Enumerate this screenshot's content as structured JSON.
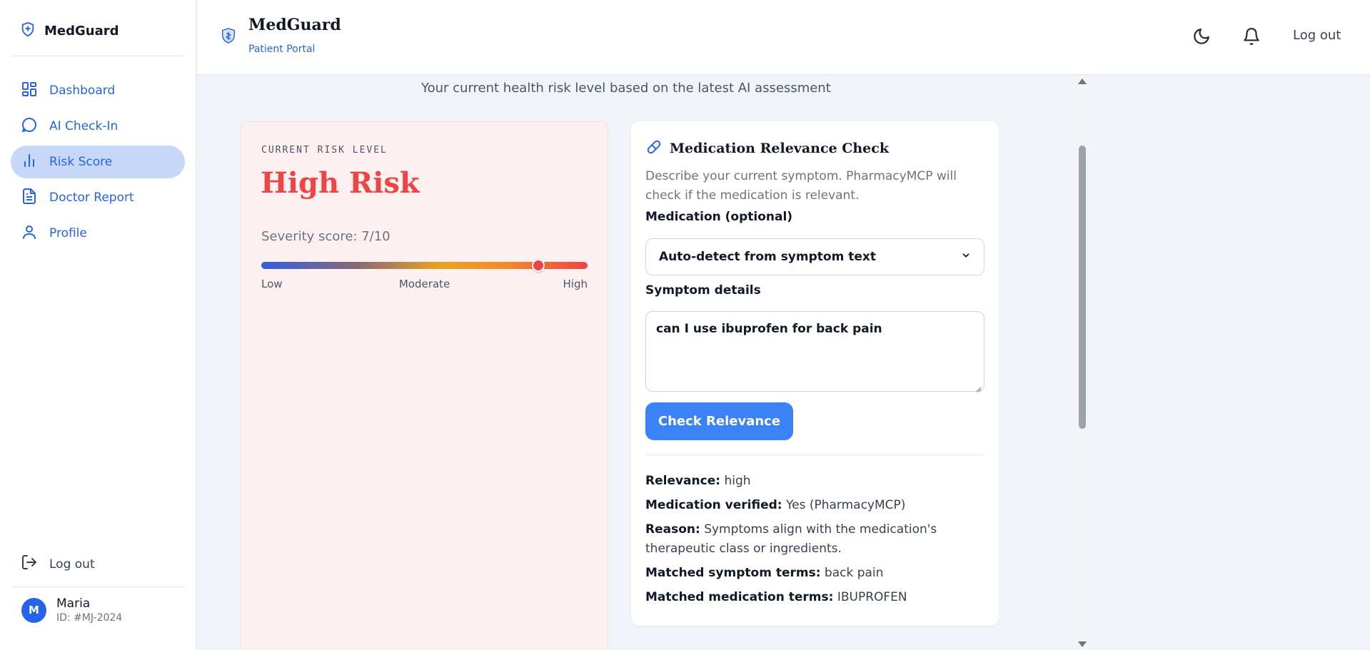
{
  "sidebar": {
    "brand": "MedGuard",
    "items": [
      {
        "label": "Dashboard",
        "icon": "dashboard-icon"
      },
      {
        "label": "AI Check-In",
        "icon": "chat-bubble-icon"
      },
      {
        "label": "Risk Score",
        "icon": "bar-chart-icon",
        "active": true
      },
      {
        "label": "Doctor Report",
        "icon": "document-icon"
      },
      {
        "label": "Profile",
        "icon": "user-icon"
      }
    ],
    "logout_label": "Log out",
    "user": {
      "initial": "M",
      "name": "Maria",
      "id": "ID: #MJ-2024"
    }
  },
  "header": {
    "title": "MedGuard",
    "subtitle": "Patient Portal",
    "logout_label": "Log out"
  },
  "main": {
    "subtitle": "Your current health risk level based on the latest AI assessment"
  },
  "risk": {
    "label": "CURRENT RISK LEVEL",
    "value": "High Risk",
    "severity_text": "Severity score: 7/10",
    "severity_fraction": 0.85,
    "scale": {
      "low": "Low",
      "moderate": "Moderate",
      "high": "High"
    }
  },
  "medication": {
    "title": "Medication Relevance Check",
    "description": "Describe your current symptom. PharmacyMCP will check if the medication is relevant.",
    "medication_label": "Medication (optional)",
    "medication_selected": "Auto-detect from symptom text",
    "symptom_label": "Symptom details",
    "symptom_value": "can I use ibuprofen for back pain",
    "button_label": "Check Relevance",
    "results": {
      "relevance_label": "Relevance:",
      "relevance_value": "high",
      "verified_label": "Medication verified:",
      "verified_value": "Yes (PharmacyMCP)",
      "reason_label": "Reason:",
      "reason_value": "Symptoms align with the medication's therapeutic class or ingredients.",
      "symptom_terms_label": "Matched symptom terms:",
      "symptom_terms_value": "back pain",
      "med_terms_label": "Matched medication terms:",
      "med_terms_value": "IBUPROFEN"
    }
  },
  "colors": {
    "accent": "#2563eb",
    "danger": "#ef4444",
    "button": "#3b82f6"
  }
}
